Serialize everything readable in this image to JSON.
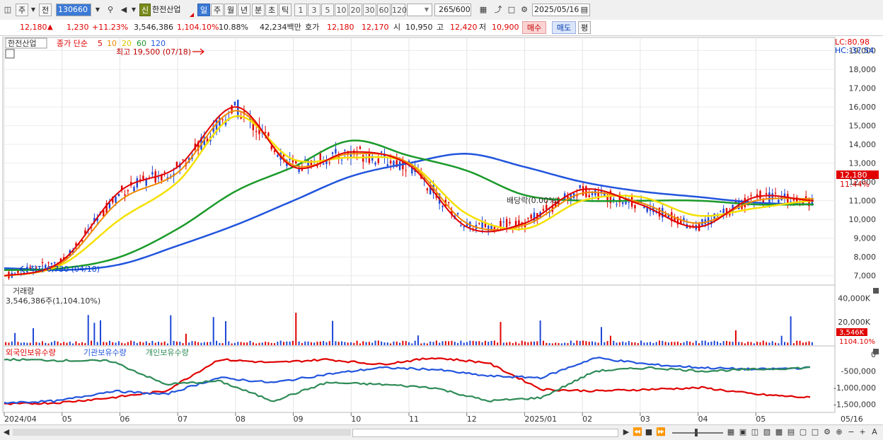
{
  "toolbar": {
    "type_btn": "주",
    "type_btn2": "전",
    "code": "130660",
    "badge_new": "신",
    "stock_name": "한전산업",
    "periods": [
      "일",
      "주",
      "월",
      "년",
      "분",
      "초",
      "틱"
    ],
    "nums": [
      "1",
      "3",
      "5",
      "10",
      "20",
      "30",
      "60",
      "120"
    ],
    "count_value": "265",
    "count_total": "/600",
    "date": "2025/05/16"
  },
  "quote": {
    "price": "12,180",
    "change_arrow": "▲",
    "change": "1,230",
    "change_pct": "+11.23%",
    "volume": "3,546,386",
    "volume_pct": "1,104.10%",
    "turnover": "10.88%",
    "amount": "42,234백만",
    "ask_label": "호가",
    "ask1": "12,180",
    "ask2": "12,170",
    "open_label": "시",
    "open": "10,950",
    "high_label": "고",
    "high": "12,420",
    "low_label": "저",
    "low": "10,900",
    "buy_label": "매수",
    "sell_label": "매도",
    "eval_label": "평"
  },
  "price_chart": {
    "stock_tag": "한전산업",
    "legend_close": "종가 단순",
    "ma_periods": [
      "5",
      "10",
      "20",
      "60",
      "120"
    ],
    "ma_colors": [
      "#e00000",
      "#f08a00",
      "#f5e000",
      "#1a9a2a",
      "#2255dd"
    ],
    "lc": "LC:80.98",
    "hc": "HC:-37.54",
    "high_annotation": "최고 19,500 (07/18)",
    "low_annotation": "최저 6,730 (04/18)",
    "dividend_annotation": "배당락(0.00%)",
    "y_labels": [
      "19,000",
      "18,000",
      "17,000",
      "16,000",
      "15,000",
      "14,000",
      "13,000",
      "12,000",
      "11,000",
      "10,000",
      "9,000",
      "8,000",
      "7,000"
    ],
    "current_price_tag": "12,180",
    "current_pct_tag": "11.44%"
  },
  "volume_chart": {
    "title": "거래량",
    "subtitle": "3,546,386주(1,104.10%)",
    "y_labels": [
      "40,000K",
      "20,000K"
    ],
    "current_tag": "3,546K",
    "current_pct": "1104.10%"
  },
  "holdings_chart": {
    "legend": [
      "외국인보유수량",
      "기관보유수량",
      "개인보유수량"
    ],
    "colors": [
      "#e00000",
      "#2255dd",
      "#2e8b57"
    ],
    "y_labels": [
      "0",
      "-500,000",
      "-1,000,000",
      "-1,500,000"
    ]
  },
  "x_axis": {
    "labels": [
      "2024/04",
      "05",
      "06",
      "07",
      "08",
      "09",
      "10",
      "11",
      "12",
      "2025/01",
      "02",
      "03",
      "04",
      "05"
    ],
    "right_label": "05/16"
  },
  "chart_data": {
    "type": "line",
    "title": "한전산업",
    "xlabel": "",
    "ylabel": "",
    "ylim": [
      6500,
      19700
    ],
    "x": [
      "2024/04",
      "05",
      "06",
      "07",
      "08",
      "09",
      "10",
      "11",
      "12",
      "2025/01",
      "02",
      "03",
      "04",
      "05",
      "05/16"
    ],
    "series": [
      {
        "name": "5",
        "values": [
          7000,
          7800,
          11500,
          12800,
          16000,
          12800,
          13600,
          12900,
          9600,
          9800,
          11600,
          10800,
          9600,
          11200,
          11000
        ]
      },
      {
        "name": "10",
        "values": [
          7000,
          7700,
          11000,
          12500,
          15800,
          12900,
          13500,
          13000,
          9800,
          9700,
          11400,
          10900,
          9800,
          11000,
          11100
        ]
      },
      {
        "name": "20",
        "values": [
          7000,
          7600,
          10000,
          12000,
          15500,
          13200,
          13300,
          13000,
          10300,
          9500,
          11000,
          11200,
          10200,
          10600,
          11000
        ]
      },
      {
        "name": "60",
        "values": [
          7300,
          7400,
          8000,
          9500,
          11500,
          12800,
          14200,
          13400,
          12600,
          11300,
          11000,
          11000,
          11000,
          10800,
          10800
        ]
      },
      {
        "name": "120",
        "values": [
          7400,
          7300,
          7600,
          8600,
          9700,
          11000,
          12300,
          13000,
          13500,
          12800,
          12000,
          11500,
          11200,
          10900,
          10800
        ]
      }
    ]
  }
}
